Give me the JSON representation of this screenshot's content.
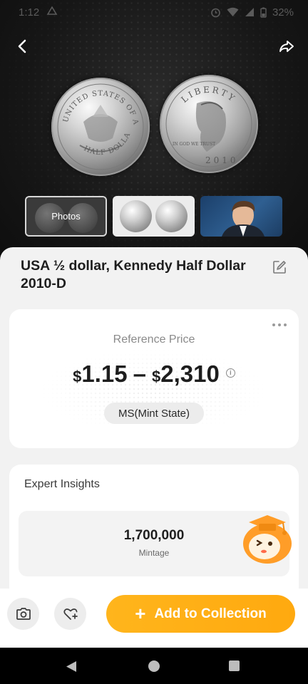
{
  "status_bar": {
    "time": "1:12",
    "battery_text": "32%",
    "icons": [
      "notification-icon",
      "alarm-icon",
      "wifi-icon",
      "signal-icon",
      "battery-icon"
    ]
  },
  "header": {
    "back_icon": "chevron-left-icon",
    "share_icon": "share-icon"
  },
  "coin_images": {
    "reverse_lettering": [
      "UNITED STATES OF AMERICA",
      "HALF DOLLAR"
    ],
    "obverse_lettering": [
      "LIBERTY",
      "IN GOD WE TRUST",
      "2010"
    ]
  },
  "gallery": {
    "thumbs": [
      {
        "label": "Photos",
        "selected": true
      },
      {
        "label": "",
        "selected": false
      },
      {
        "label": "",
        "selected": false
      }
    ]
  },
  "coin": {
    "title": "USA ½ dollar, Kennedy Half Dollar 2010-D",
    "edit_icon": "edit-icon"
  },
  "price": {
    "label": "Reference Price",
    "low_symbol": "$",
    "low_value": "1.15",
    "separator": "–",
    "high_symbol": "$",
    "high_value": "2,310",
    "info_icon": "i",
    "grade": "MS(Mint State)"
  },
  "insights": {
    "title": "Expert Insights",
    "mintage_value": "1,700,000",
    "mintage_label": "Mintage"
  },
  "actions": {
    "camera_icon": "camera-icon",
    "wishlist_icon": "heart-plus-icon",
    "plus": "+",
    "add_label": "Add to Collection"
  },
  "colors": {
    "accent": "#FFAE16",
    "sheet_bg": "#F2F2F2",
    "hero_bg": "#161616"
  }
}
